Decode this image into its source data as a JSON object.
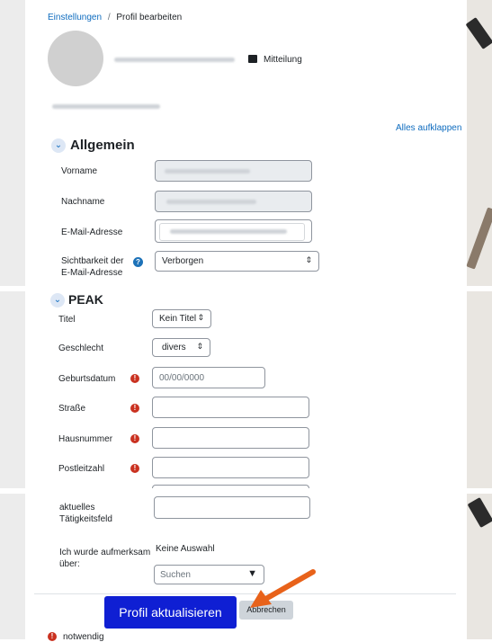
{
  "breadcrumb": {
    "root": "Einstellungen",
    "separator": "/",
    "current": "Profil bearbeiten"
  },
  "header": {
    "message_label": "Mitteilung"
  },
  "expand_all": "Alles aufklappen",
  "allgemein": {
    "title": "Allgemein",
    "vorname": "Vorname",
    "nachname": "Nachname",
    "email": "E-Mail-Adresse",
    "sichtbarkeit_line1": "Sichtbarkeit der",
    "sichtbarkeit_line2": "E-Mail-Adresse",
    "sichtbarkeit_value": "Verborgen"
  },
  "peak": {
    "title": "PEAK",
    "titel_label": "Titel",
    "titel_value": "Kein Titel",
    "geschlecht_label": "Geschlecht",
    "geschlecht_value": "divers",
    "geburtsdatum_label": "Geburtsdatum",
    "geburtsdatum_placeholder": "00/00/0000",
    "strasse_label": "Straße",
    "hausnummer_label": "Hausnummer",
    "postleitzahl_label": "Postleitzahl",
    "taetigkeit_line1": "aktuelles",
    "taetigkeit_line2": "Tätigkeitsfeld",
    "aufmerksam_line1": "Ich wurde aufmerksam",
    "aufmerksam_line2": "über:",
    "aufmerksam_value": "Keine Auswahl",
    "search_placeholder": "Suchen"
  },
  "buttons": {
    "update": "Profil aktualisieren",
    "cancel": "Abbrechen"
  },
  "footer": {
    "required_label": "notwendig"
  },
  "colors": {
    "primary_button": "#0f1fd3",
    "required": "#ca3120",
    "arrow": "#e8621a",
    "link": "#0f6cbf"
  }
}
